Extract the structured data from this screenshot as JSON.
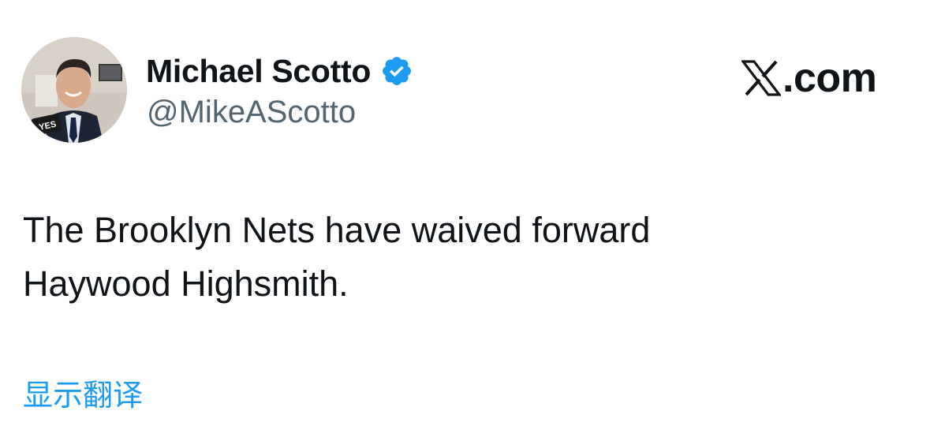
{
  "author": {
    "name": "Michael Scotto",
    "handle": "@MikeAScotto",
    "verified": true,
    "avatar_icon": "profile-photo",
    "avatar_logo_text": "YES"
  },
  "brand": {
    "text": ".com",
    "icon": "x-logo-icon"
  },
  "tweet": {
    "lines": [
      "The Brooklyn Nets have waived forward",
      "Haywood Highsmith."
    ]
  },
  "actions": {
    "translate_label": "显示翻译"
  },
  "colors": {
    "text": "#0f1419",
    "secondary": "#536471",
    "accent": "#1d9bf0",
    "background": "#ffffff"
  }
}
